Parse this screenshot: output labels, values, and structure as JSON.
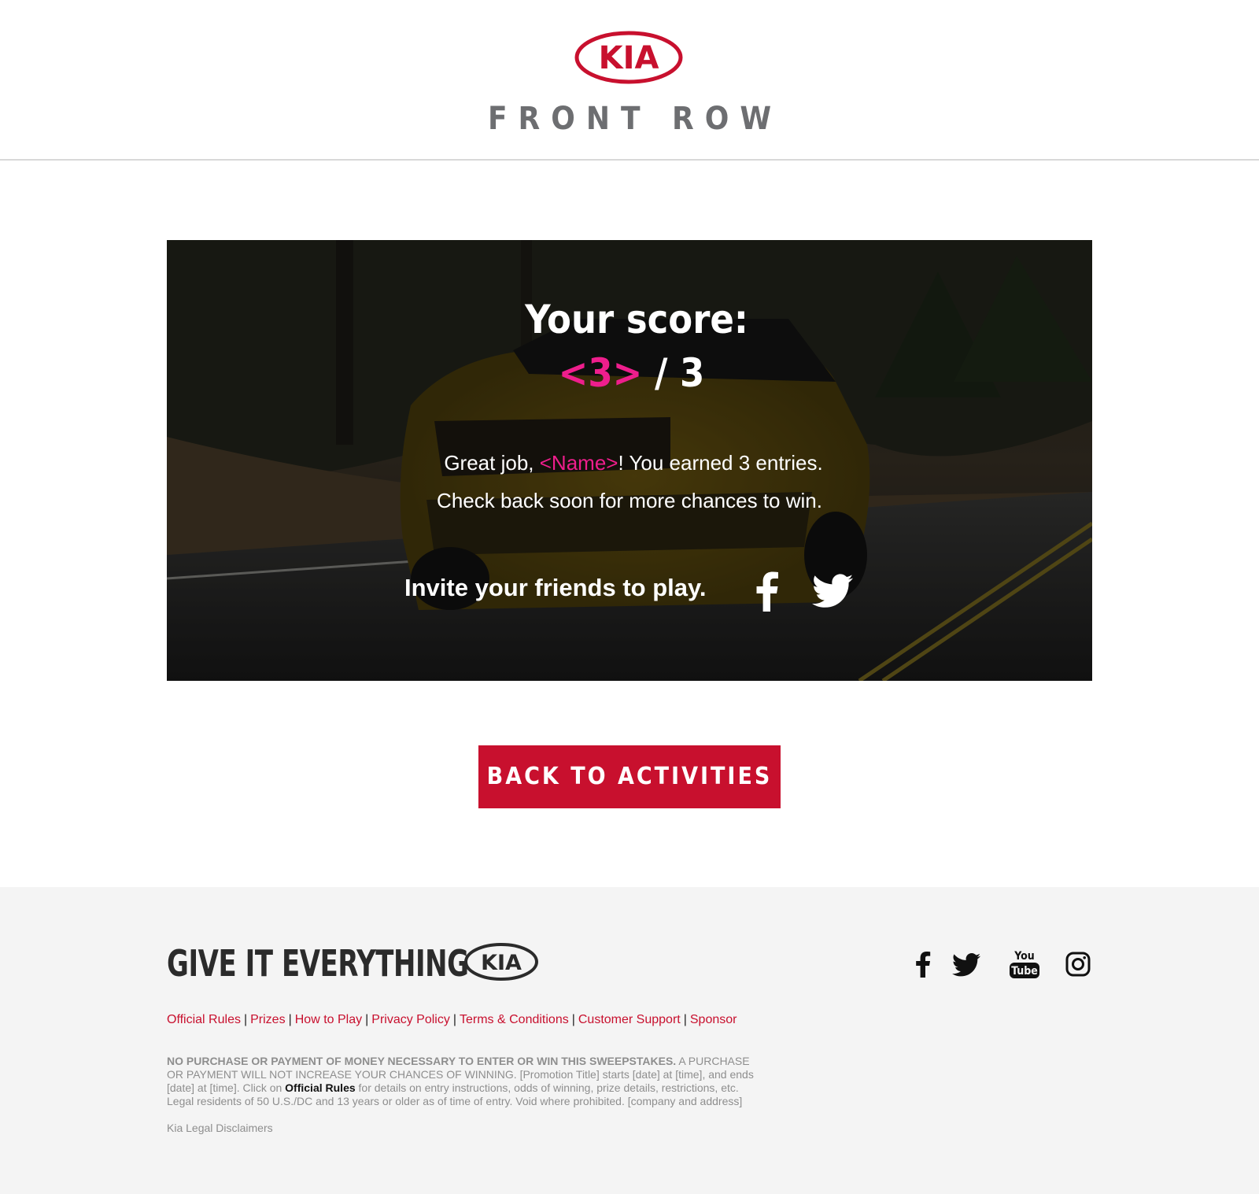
{
  "header": {
    "brand": "KIA",
    "subtitle": "FRONT ROW"
  },
  "hero": {
    "score_title": "Your score:",
    "score_value": "<3>",
    "score_total": " / 3",
    "message_prefix": "Great job, ",
    "message_name": "<Name>",
    "message_suffix": "! You earned 3 entries.",
    "message_line2": "Check back soon for more chances to win.",
    "invite_text": "Invite your friends to play."
  },
  "button": {
    "back_label": "BACK TO ACTIVITIES"
  },
  "footer": {
    "tagline": "GIVE IT EVERYTHING",
    "brand": "KIA",
    "links": [
      "Official Rules",
      "Prizes",
      "How to Play",
      "Privacy Policy",
      "Terms & Conditions",
      "Customer Support",
      "Sponsor"
    ],
    "link_separator": "|",
    "legal_bold": "NO PURCHASE OR PAYMENT OF MONEY NECESSARY TO ENTER OR WIN THIS SWEEPSTAKES.",
    "legal_part1": " A PURCHASE OR PAYMENT WILL NOT INCREASE YOUR CHANCES OF WINNING. [Promotion Title] starts [date] at [time], and ends [date] at [time]. Click on ",
    "legal_link": "Official Rules",
    "legal_part2": " for details on entry instructions, odds of winning, prize details, restrictions, etc. Legal residents of 50 U.S./DC and 13 years or older as of time of entry. Void where prohibited. [company and address]",
    "disclaimers": "Kia Legal Disclaimers",
    "youtube_top": "You",
    "youtube_bottom": "Tube"
  },
  "colors": {
    "brand_red": "#c8102e",
    "highlight_pink": "#ee1e8c",
    "footer_bg": "#f4f4f4"
  },
  "icons": [
    "kia-logo",
    "facebook-icon",
    "twitter-icon",
    "youtube-icon",
    "instagram-icon"
  ]
}
